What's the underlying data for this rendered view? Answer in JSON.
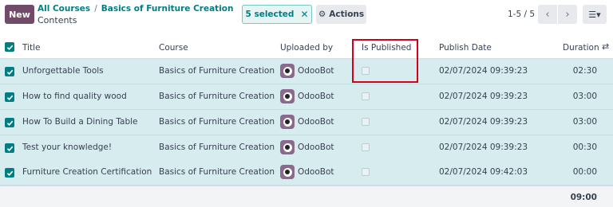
{
  "control_panel": {
    "new_label": "New",
    "breadcrumb": [
      "All Courses",
      "Basics of Furniture Creation"
    ],
    "breadcrumb_sep": "/",
    "title": "Contents",
    "selected_label": "5 selected",
    "clear_icon": "close-icon",
    "actions_label": "Actions",
    "actions_icon": "gear-icon",
    "pager": "1-5 / 5",
    "view_icon": "list-view-icon"
  },
  "table": {
    "headers": {
      "title": "Title",
      "course": "Course",
      "uploaded_by": "Uploaded by",
      "is_published": "Is Published",
      "publish_date": "Publish Date",
      "duration": "Duration"
    },
    "rows": [
      {
        "title": "Unforgettable Tools",
        "course": "Basics of Furniture Creation",
        "uploaded_by": "OdooBot",
        "is_published": false,
        "publish_date": "02/07/2024 09:39:23",
        "duration": "02:30"
      },
      {
        "title": "How to find quality wood",
        "course": "Basics of Furniture Creation",
        "uploaded_by": "OdooBot",
        "is_published": false,
        "publish_date": "02/07/2024 09:39:23",
        "duration": "03:00"
      },
      {
        "title": "How To Build a Dining Table",
        "course": "Basics of Furniture Creation",
        "uploaded_by": "OdooBot",
        "is_published": false,
        "publish_date": "02/07/2024 09:39:23",
        "duration": "03:00"
      },
      {
        "title": "Test your knowledge!",
        "course": "Basics of Furniture Creation",
        "uploaded_by": "OdooBot",
        "is_published": false,
        "publish_date": "02/07/2024 09:39:23",
        "duration": "00:30"
      },
      {
        "title": "Furniture Creation Certification",
        "course": "Basics of Furniture Creation",
        "uploaded_by": "OdooBot",
        "is_published": false,
        "publish_date": "02/07/2024 09:42:03",
        "duration": "00:00"
      }
    ],
    "total_duration": "09:00"
  },
  "colors": {
    "brand": "#714B67",
    "accent": "#017e84",
    "selected_row": "#d7ecef",
    "highlight": "#d0021b"
  }
}
